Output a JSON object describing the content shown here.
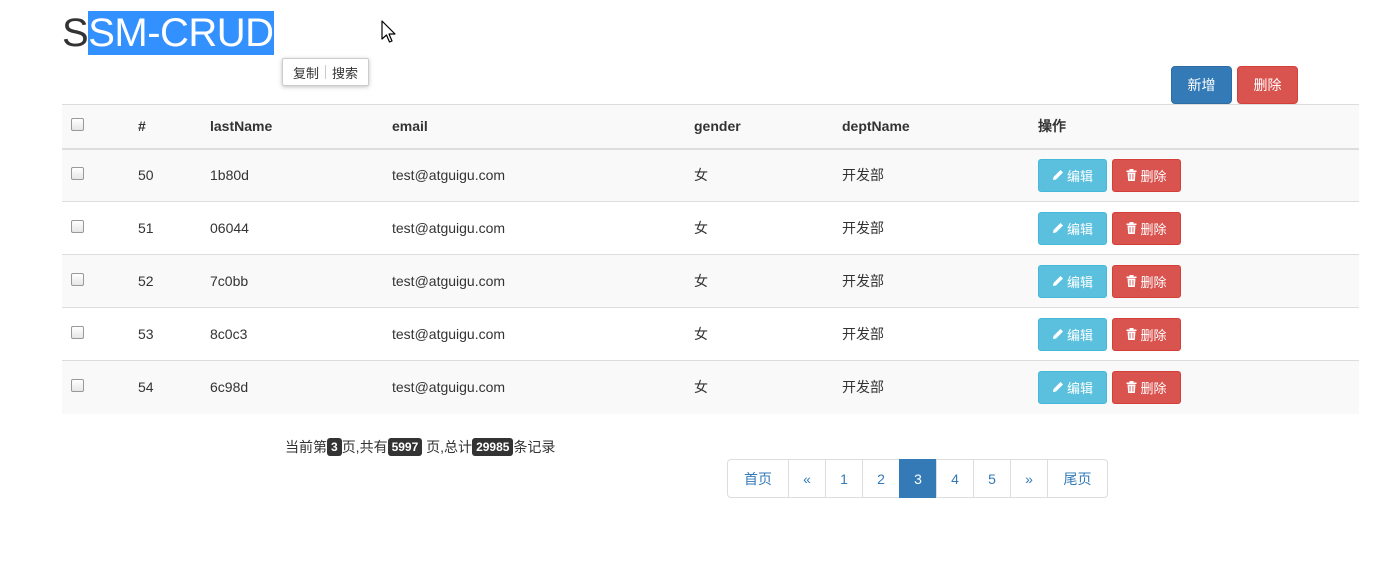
{
  "header": {
    "title_first_char": "S",
    "title_selected": "SM-CRUD"
  },
  "context_menu": {
    "copy": "复制",
    "search": "搜索"
  },
  "toolbar": {
    "add_label": "新增",
    "delete_label": "删除"
  },
  "table": {
    "columns": [
      "#",
      "lastName",
      "email",
      "gender",
      "deptName",
      "操作"
    ],
    "rows": [
      {
        "id": "50",
        "lastName": "1b80d",
        "email": "test@atguigu.com",
        "gender": "女",
        "deptName": "开发部"
      },
      {
        "id": "51",
        "lastName": "06044",
        "email": "test@atguigu.com",
        "gender": "女",
        "deptName": "开发部"
      },
      {
        "id": "52",
        "lastName": "7c0bb",
        "email": "test@atguigu.com",
        "gender": "女",
        "deptName": "开发部"
      },
      {
        "id": "53",
        "lastName": "8c0c3",
        "email": "test@atguigu.com",
        "gender": "女",
        "deptName": "开发部"
      },
      {
        "id": "54",
        "lastName": "6c98d",
        "email": "test@atguigu.com",
        "gender": "女",
        "deptName": "开发部"
      }
    ],
    "edit_label": "编辑",
    "delete_label": "删除"
  },
  "page_info": {
    "prefix": "当前第",
    "current": "3",
    "mid1": "页,共有",
    "total_pages": "5997",
    "mid2": " 页,总计",
    "total_records": "29985",
    "suffix": "条记录"
  },
  "pagination": {
    "first": "首页",
    "prev": "«",
    "pages": [
      "1",
      "2",
      "3",
      "4",
      "5"
    ],
    "active": "3",
    "next": "»",
    "last": "尾页"
  },
  "colors": {
    "primary": "#337ab7",
    "danger": "#d9534f",
    "info": "#5bc0de",
    "selection": "#3390ff"
  }
}
